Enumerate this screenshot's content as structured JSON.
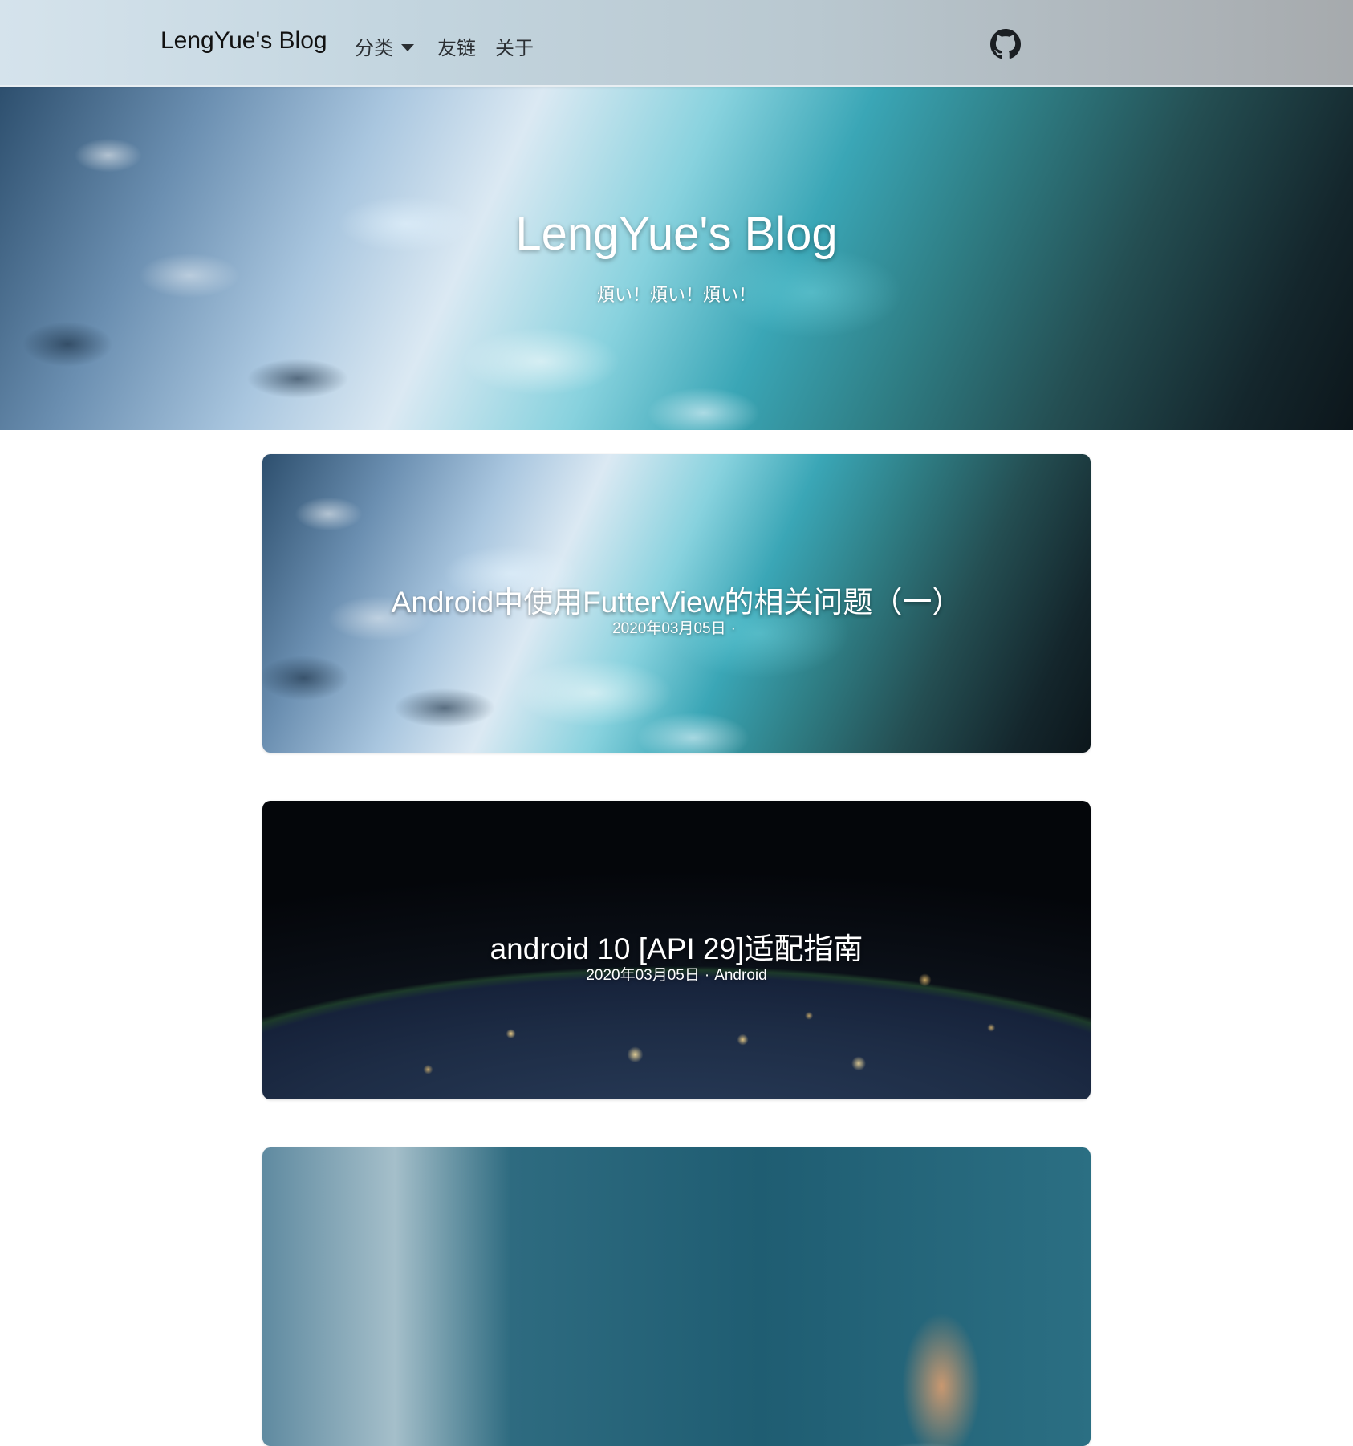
{
  "nav": {
    "brand": "LengYue's Blog",
    "items": [
      {
        "label": "分类"
      },
      {
        "label": "友链"
      },
      {
        "label": "关于"
      }
    ],
    "github_icon": "github-icon"
  },
  "hero": {
    "title": "LengYue's Blog",
    "subtitle": "煩い！煩い！煩い！"
  },
  "posts": [
    {
      "title": "Android中使用FutterView的相关问题（一）",
      "date": "2020年03月05日",
      "separator": "·",
      "category": ""
    },
    {
      "title": "android 10 [API 29]适配指南",
      "date": "2020年03月05日",
      "separator": "·",
      "category": "Android"
    },
    {
      "title": "",
      "date": "",
      "separator": "",
      "category": ""
    }
  ],
  "colors": {
    "nav_text": "#2b2f33",
    "brand_text": "#111111",
    "overlay_text": "#ffffff"
  }
}
